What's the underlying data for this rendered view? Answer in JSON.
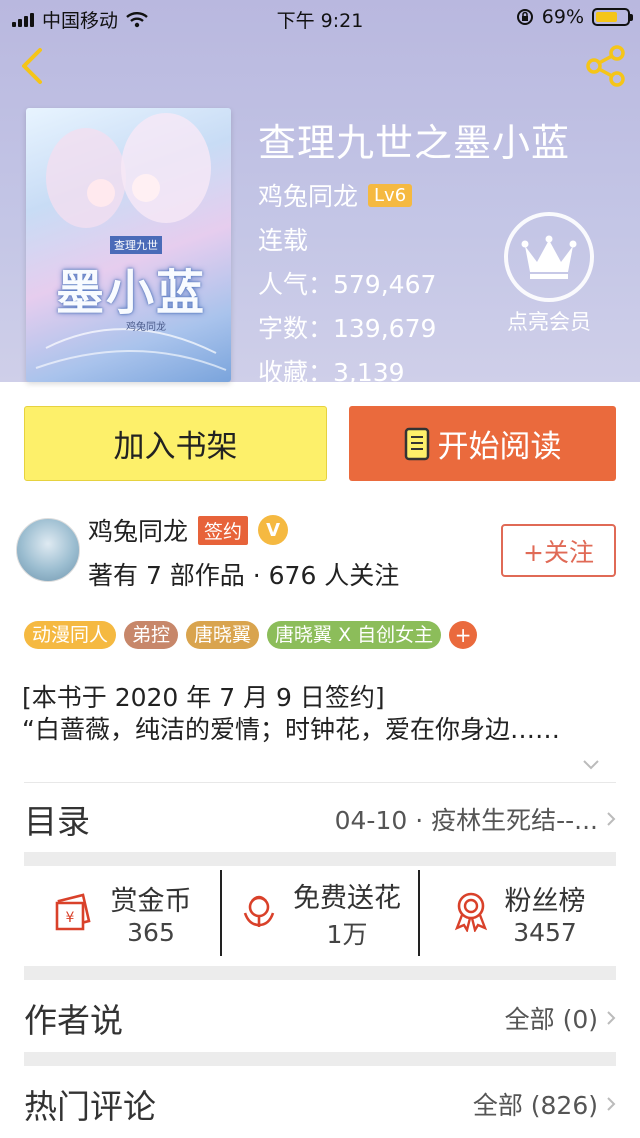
{
  "status_bar": {
    "carrier": "中国移动",
    "time": "下午 9:21",
    "battery": "69%",
    "battery_level": 0.69
  },
  "book": {
    "title": "查理九世之墨小蓝",
    "author": "鸡兔同龙",
    "level": "Lv6",
    "status": "连载",
    "popularity": "人气：579,467",
    "word_count": "字数：139,679",
    "favorites": "收藏：3,139",
    "cover": {
      "title": "墨小蓝",
      "series": "查理九世",
      "author": "鸡兔同龙"
    }
  },
  "vip": {
    "label": "点亮会员"
  },
  "actions": {
    "add_shelf": "加入书架",
    "start_reading": "开始阅读"
  },
  "author": {
    "name": "鸡兔同龙",
    "badge": "签约",
    "verified": "V",
    "meta": "著有 7 部作品 · 676 人关注",
    "follow": "+关注"
  },
  "tags": [
    {
      "label": "动漫同人",
      "color": "#f5b941"
    },
    {
      "label": "弟控",
      "color": "#c7876a"
    },
    {
      "label": "唐晓翼",
      "color": "#d9a44e"
    },
    {
      "label": "唐晓翼 X 自创女主",
      "color": "#8cbd5a"
    }
  ],
  "tag_more": "+",
  "description": {
    "line1": "[本书于 2020 年 7 月 9 日签约]",
    "line2": "“白蔷薇，纯洁的爱情；时钟花，爱在你身边……"
  },
  "toc": {
    "title": "目录",
    "latest": "04-10 · 疫林生死结--..."
  },
  "stats": [
    {
      "label": "赏金币",
      "value": "365",
      "icon": "red-envelope-icon"
    },
    {
      "label": "免费送花",
      "value": "1万",
      "icon": "flower-icon"
    },
    {
      "label": "粉丝榜",
      "value": "3457",
      "icon": "ribbon-medal-icon"
    }
  ],
  "author_says": {
    "title": "作者说",
    "value": "全部 (0)"
  },
  "hot_comments": {
    "title": "热门评论",
    "value": "全部 (826)"
  },
  "colors": {
    "accent": "#ea6a3d",
    "shelf": "#fdf06a",
    "tag_orange": "#f5b941"
  }
}
